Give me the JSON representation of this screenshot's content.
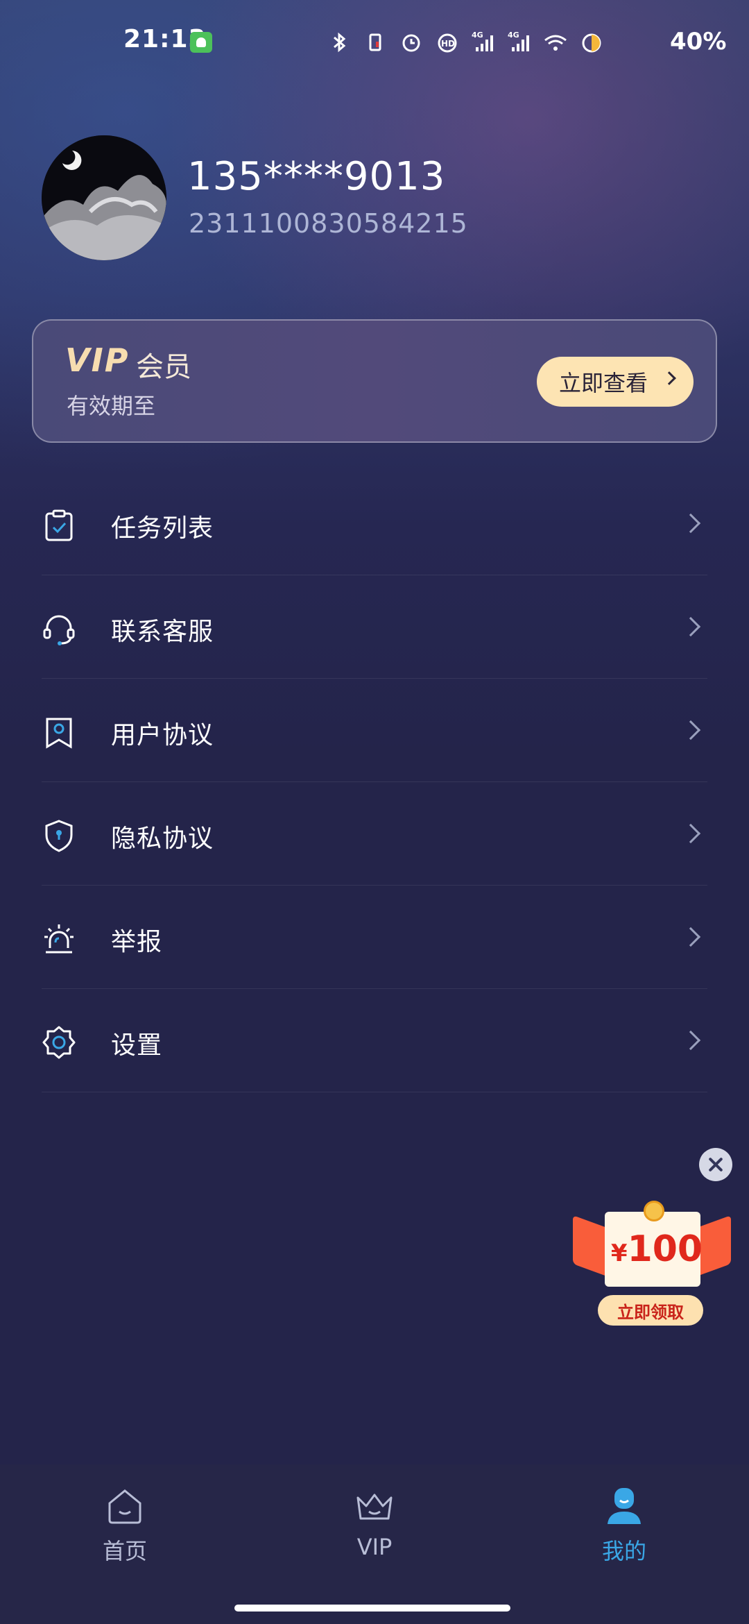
{
  "status_bar": {
    "time": "21:13",
    "battery_text": "40%",
    "icons": [
      "bluetooth-icon",
      "vibrate-icon",
      "alarm-icon",
      "hd-icon",
      "signal-4g-icon",
      "signal-4g-icon",
      "wifi-icon",
      "battery-icon"
    ]
  },
  "profile": {
    "phone": "135****9013",
    "uid": "2311100830584215"
  },
  "vip": {
    "logo": "VIP",
    "title": "会员",
    "expiry_label": "有效期至",
    "button_label": "立即查看"
  },
  "menu": {
    "items": [
      {
        "label": "任务列表",
        "icon": "task-list-icon"
      },
      {
        "label": "联系客服",
        "icon": "headset-icon"
      },
      {
        "label": "用户协议",
        "icon": "bookmark-user-icon"
      },
      {
        "label": "隐私协议",
        "icon": "shield-lock-icon"
      },
      {
        "label": "举报",
        "icon": "alarm-siren-icon"
      },
      {
        "label": "设置",
        "icon": "gear-icon"
      }
    ]
  },
  "promo": {
    "currency": "¥",
    "amount": "100",
    "button_label": "立即领取"
  },
  "bottom_nav": {
    "items": [
      {
        "label": "首页",
        "icon": "home-icon",
        "active": false
      },
      {
        "label": "VIP",
        "icon": "crown-icon",
        "active": false
      },
      {
        "label": "我的",
        "icon": "profile-icon",
        "active": true
      }
    ]
  },
  "colors": {
    "accent": "#3aa7e6",
    "vip_gold": "#f7ddb0",
    "vip_button_bg": "#fde4b3",
    "background": "#24244a"
  }
}
